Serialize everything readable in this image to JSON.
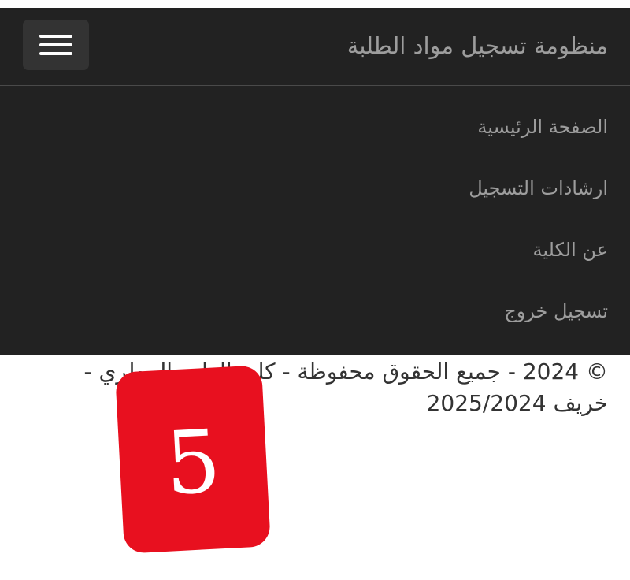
{
  "header": {
    "brand": "منظومة تسجيل مواد الطلبة",
    "toggle_icon": "hamburger-menu-icon"
  },
  "menu": {
    "items": [
      {
        "label": "الصفحة الرئيسية"
      },
      {
        "label": "ارشادات التسجيل"
      },
      {
        "label": "عن الكلية"
      },
      {
        "label": "تسجيل خروج"
      }
    ]
  },
  "footer": {
    "text": "© 2024 - جميع الحقوق محفوظة - كلية الطب البيطري - خريف 2025/2024"
  },
  "sticker": {
    "number": "5",
    "color": "#e8101f"
  },
  "colors": {
    "navbar_bg": "#222222",
    "nav_text": "#9d9d9d",
    "toggle_bg": "#333333"
  }
}
